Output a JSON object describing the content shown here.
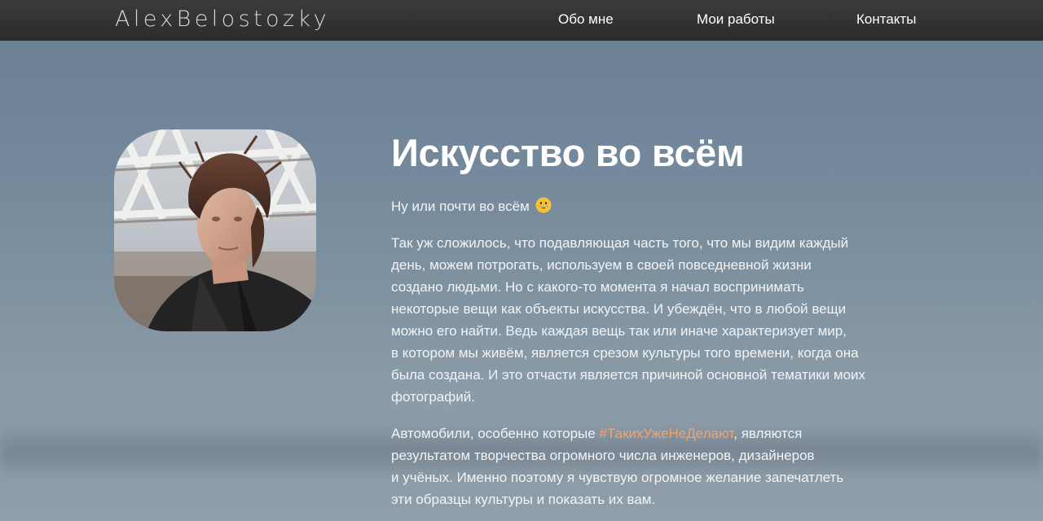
{
  "header": {
    "logo": "AlexBelostozky",
    "nav": [
      {
        "label": "Обо мне"
      },
      {
        "label": "Мои работы"
      },
      {
        "label": "Контакты"
      }
    ]
  },
  "main": {
    "title": "Искусство во всём",
    "intro": "Ну или почти во всём",
    "intro_emoji": "grinning-face-icon",
    "paragraph1_lines": [
      "Так уж сложилось, что подавляющая часть того, что мы видим каждый",
      "день, можем потрогать, используем в своей повседневной жизни",
      "создано людьми. Но с какого-то момента я начал воспринимать",
      "некоторые вещи как объекты искусства. И убеждён, что в любой вещи",
      "можно его найти. Ведь каждая вещь так или иначе характеризует мир,",
      "в котором мы живём, является срезом культуры того времени, когда она",
      "была создана. И это отчасти является причиной основной тематики моих",
      "фотографий."
    ],
    "paragraph2_prefix": "Автомобили, особенно которые ",
    "paragraph2_hashtag": "#ТакихУжеНеДелают",
    "paragraph2_suffix_first": ", являются",
    "paragraph2_lines": [
      "результатом творчества огромного числа инженеров, дизайнеров",
      "и учёных. Именно поэтому я чувствую огромное желание запечатлеть",
      "эти образцы культуры и показать их вам."
    ]
  },
  "colors": {
    "header_bg": "#2d2e30",
    "hashtag": "#f4a26b",
    "text": "#ffffff"
  }
}
